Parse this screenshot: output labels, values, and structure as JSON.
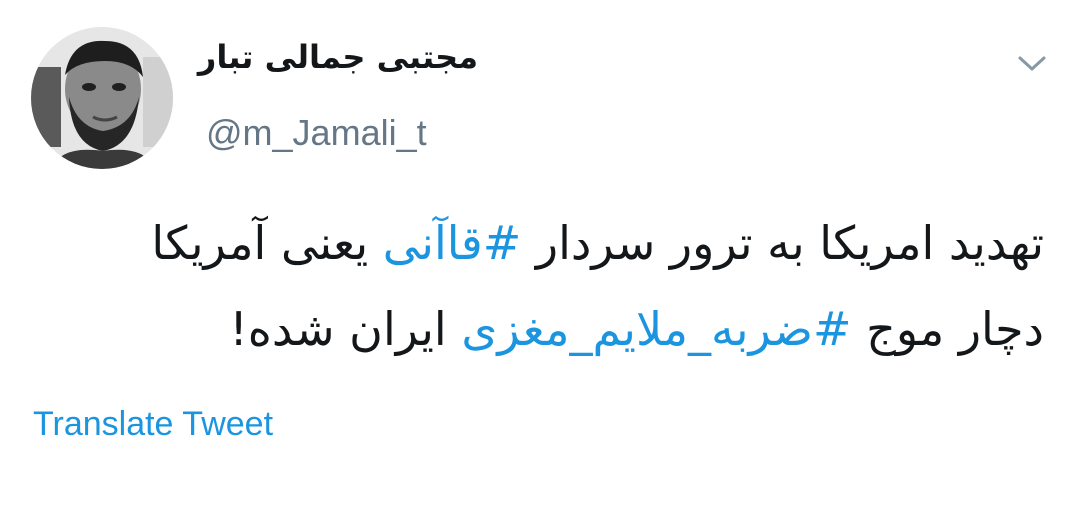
{
  "user": {
    "display_name": "مجتبی جمالی تبار",
    "handle": "@m_Jamali_t"
  },
  "tweet": {
    "line1_before": "تهدید امریکا به ترور سردار ",
    "hashtag1": "#قاآنی",
    "line1_after": " یعنی آمریکا",
    "line2_before": "دچار موج ",
    "hashtag2": "#ضربه_ملایم_مغزی",
    "line2_after": " ایران شده!"
  },
  "actions": {
    "translate_label": "Translate Tweet"
  },
  "icons": {
    "menu": "chevron-down-icon",
    "avatar": "profile-photo"
  },
  "colors": {
    "link": "#1b95e0",
    "text": "#14171a",
    "secondary": "#657786"
  }
}
